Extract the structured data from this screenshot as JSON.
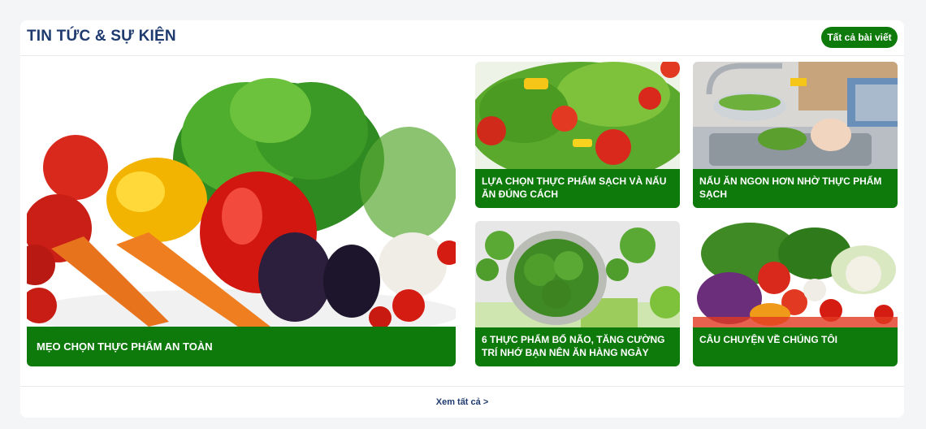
{
  "section": {
    "title": "TIN TỨC & SỰ KIỆN",
    "all_posts_label": "Tất cả bài viết",
    "view_all_label": "Xem tất cả >"
  },
  "articles": [
    {
      "title": "MẸO CHỌN THỰC PHẨM AN TOÀN"
    },
    {
      "title": "LỰA CHỌN THỰC PHẨM SẠCH VÀ NẤU ĂN ĐÚNG CÁCH"
    },
    {
      "title": "NẤU ĂN NGON HƠN NHỜ THỰC PHẨM SẠCH"
    },
    {
      "title": "6 THỰC PHẨM BỔ NÃO, TĂNG CƯỜNG TRÍ NHỚ BẠN NÊN ĂN HÀNG NGÀY"
    },
    {
      "title": "CÂU CHUYỆN VỀ CHÚNG TÔI"
    }
  ],
  "colors": {
    "accent_green": "#0f7a0c",
    "title_navy": "#1e3a6e"
  }
}
